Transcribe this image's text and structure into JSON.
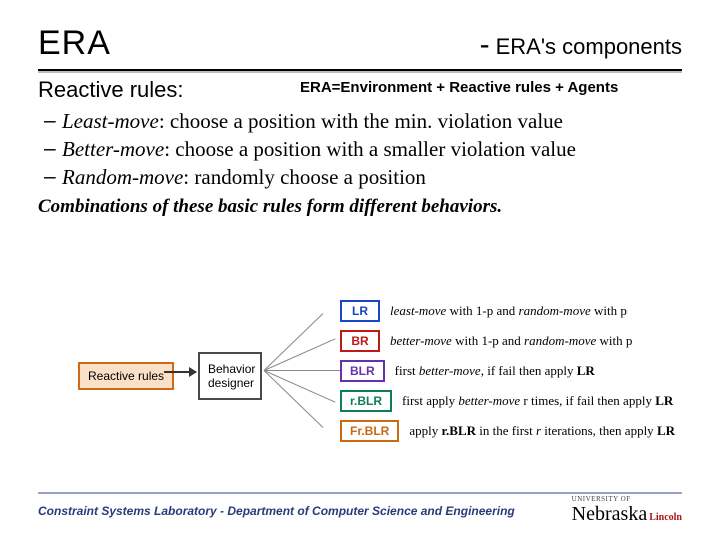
{
  "header": {
    "left": "ERA",
    "right_dash": "-",
    "right": "ERA's components"
  },
  "acronym_line": "ERA=Environment + Reactive rules + Agents",
  "subtitle": "Reactive rules:",
  "bullets": [
    {
      "name": "Least-move",
      "desc": ": choose a position with the min. violation value"
    },
    {
      "name": "Better-move",
      "desc": ": choose a position with a smaller violation value"
    },
    {
      "name": "Random-move",
      "desc": ": randomly choose a position"
    }
  ],
  "conclusion": "Combinations of these basic rules form different behaviors.",
  "diagram": {
    "reactive_label": "Reactive rules",
    "designer_label": "Behavior designer",
    "rules": [
      {
        "code": "LR",
        "color": "c-blue",
        "desc_html": "<span class='bi'>least-move</span> with 1-p and <span class='bi'>random-move</span> with p"
      },
      {
        "code": "BR",
        "color": "c-red",
        "desc_html": "<span class='bi'>better-move</span> with 1-p and <span class='bi'>random-move</span> with p"
      },
      {
        "code": "BLR",
        "color": "c-purple",
        "desc_html": "first <span class='bi'>better-move</span>, if fail then apply <b>LR</b>"
      },
      {
        "code": "r.BLR",
        "color": "c-teal",
        "desc_html": "first apply <span class='bi'>better-move</span> r times, if fail then apply <b>LR</b>"
      },
      {
        "code": "Fr.BLR",
        "color": "c-orange",
        "desc_html": "apply <b>r.BLR</b> in the first <span class='bi'>r</span> iterations, then apply <b>LR</b>"
      }
    ]
  },
  "footer": {
    "lab": "Constraint Systems Laboratory - Department of Computer Science and Engineering",
    "logo": {
      "uni": "UNIVERSITY OF",
      "name": "Nebraska",
      "city": "Lincoln"
    }
  }
}
